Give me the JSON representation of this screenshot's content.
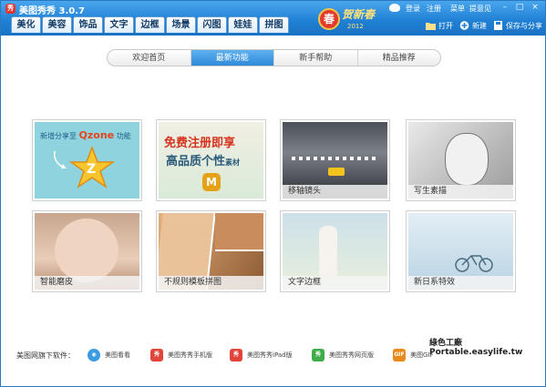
{
  "window": {
    "title": "美图秀秀 3.0.7",
    "logo_text": "秀"
  },
  "main_tabs": [
    "美化",
    "美容",
    "饰品",
    "文字",
    "边框",
    "场景",
    "闪图",
    "娃娃",
    "拼图"
  ],
  "banner": {
    "badge": "春",
    "script": "贺新春",
    "year": "2012"
  },
  "top_links": [
    "登录",
    "注册",
    "菜单",
    "提意见"
  ],
  "window_buttons": [
    "–",
    "□",
    "×"
  ],
  "actions": {
    "open": "打开",
    "new": "新建",
    "save_share": "保存与分享"
  },
  "sub_tabs": [
    {
      "label": "欢迎首页",
      "active": false
    },
    {
      "label": "最新功能",
      "active": true
    },
    {
      "label": "新手帮助",
      "active": false
    },
    {
      "label": "精品推荐",
      "active": false
    }
  ],
  "cards": {
    "qzone": {
      "line1": "新增分享至",
      "line1_brand": "Qzone",
      "line1_tail": "功能",
      "badge": "Z"
    },
    "member": {
      "line1": "免费注册即享",
      "line2": "高品质个性",
      "line2_tail": "素材",
      "badge": "M"
    },
    "tilt": {
      "caption": "移轴镜头"
    },
    "sketch": {
      "caption": "写生素描"
    },
    "skin": {
      "caption": "智能磨皮"
    },
    "frame": {
      "caption": "不规则模板拼图"
    },
    "textframe": {
      "caption": "文字边框"
    },
    "japan": {
      "caption": "新日系特效"
    }
  },
  "bottom": {
    "label": "美图网旗下软件：",
    "downloads": [
      {
        "label": "美图看看",
        "color": "#3b9be0",
        "icon": "eye-icon"
      },
      {
        "label": "美图秀秀手机版",
        "color": "#e0443a",
        "icon": "phone-app-icon"
      },
      {
        "label": "美图秀秀iPad版",
        "color": "#e0443a",
        "icon": "ipad-app-icon"
      },
      {
        "label": "美图秀秀网页版",
        "color": "#3fae4a",
        "icon": "web-app-icon"
      },
      {
        "label": "美图GIF",
        "color": "#e88a1c",
        "icon": "gif-icon"
      }
    ]
  },
  "watermark": "綠色工廠 Portable.easylife.tw",
  "colors": {
    "titlebar": "#1f7fd3",
    "active_tab": "#2f8ad9",
    "qzone_bg": "#8fd3de",
    "member_accent": "#e5a219"
  }
}
